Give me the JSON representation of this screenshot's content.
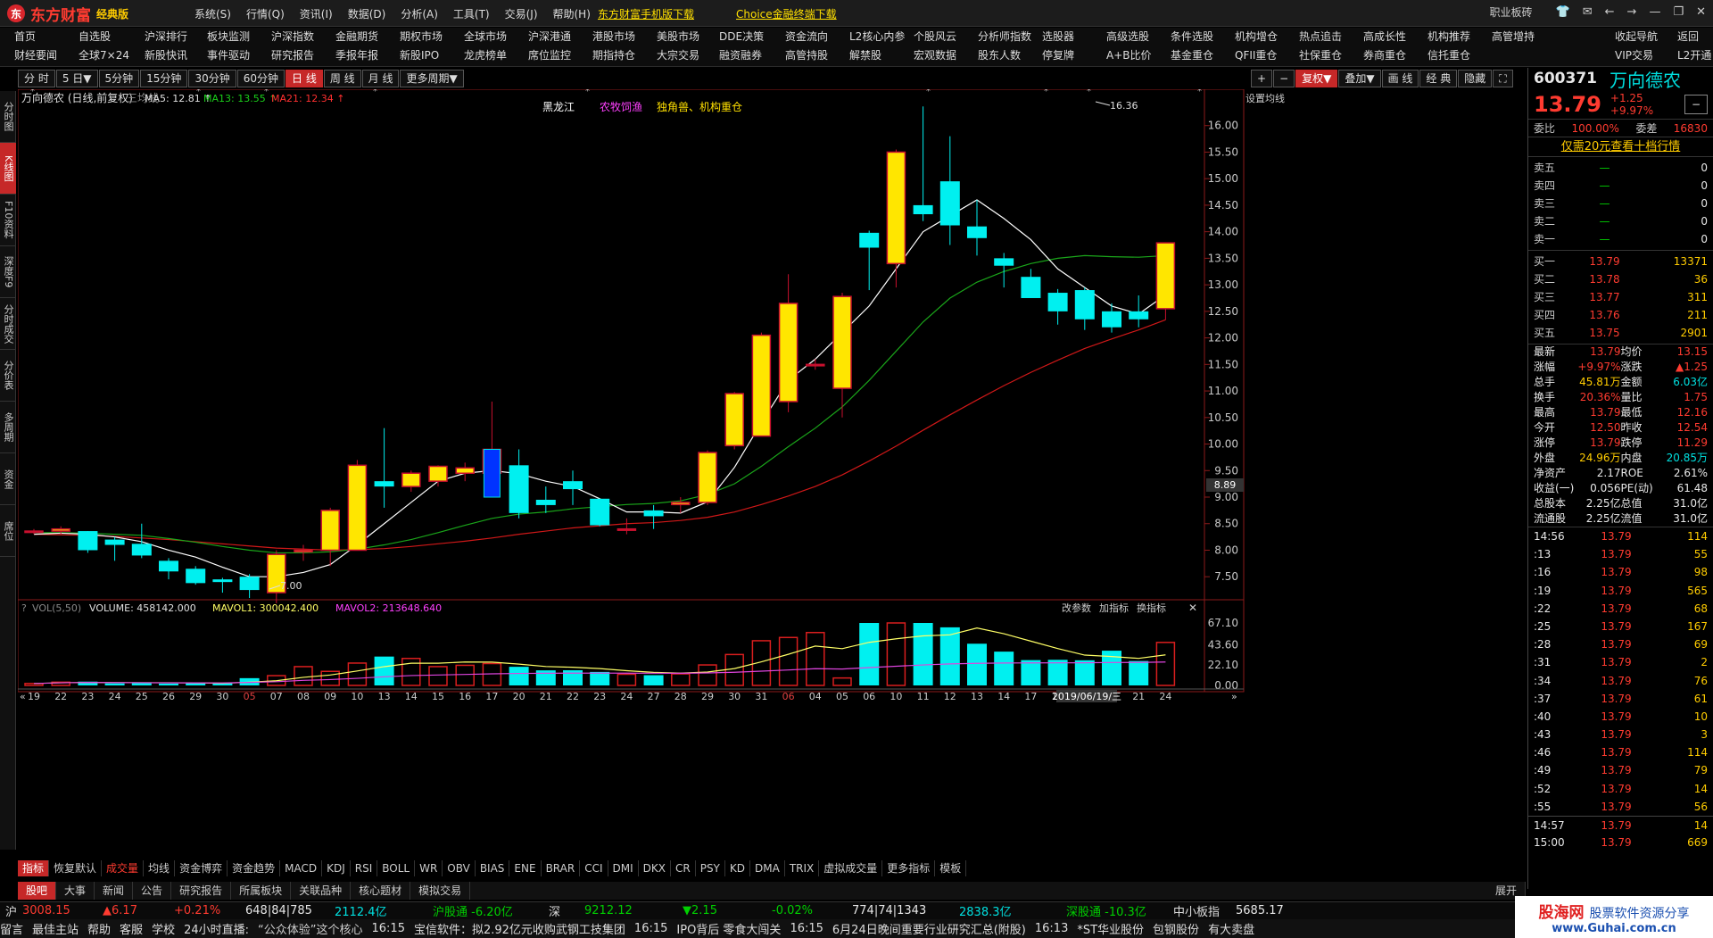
{
  "title": {
    "logo_cn": "东方财富",
    "edition": "经典版",
    "menus": [
      "系统(S)",
      "行情(Q)",
      "资讯(I)",
      "数据(D)",
      "分析(A)",
      "工具(T)",
      "交易(J)",
      "帮助(H)"
    ],
    "link1": "东方财富手机版下载",
    "link2": "Choice金融终端下载",
    "right": "职业板砖"
  },
  "nav": {
    "row1": [
      "首页",
      "自选股",
      "沪深排行",
      "板块监测",
      "沪深指数",
      "金融期货",
      "期权市场",
      "全球市场",
      "沪深港通",
      "港股市场",
      "美股市场",
      "DDE决策",
      "资金流向",
      "L2核心内参",
      "个股风云",
      "分析师指数",
      "选股器",
      "高级选股",
      "条件选股",
      "机构增仓",
      "热点追击",
      "高成长性",
      "机构推荐",
      "高管增持",
      "收起导航",
      "返回"
    ],
    "row2": [
      "财经要闻",
      "全球7×24",
      "新股快讯",
      "事件驱动",
      "研究报告",
      "季报年报",
      "新股IPO",
      "龙虎榜单",
      "席位监控",
      "期指持仓",
      "大宗交易",
      "融资融券",
      "高管持股",
      "解禁股",
      "宏观数据",
      "股东人数",
      "停复牌",
      "A+B比价",
      "基金重仓",
      "QFII重仓",
      "社保重仓",
      "券商重仓",
      "信托重仓",
      "",
      "VIP交易",
      "L2开通"
    ]
  },
  "toolbar": {
    "left": [
      "分 时",
      "5 日▼",
      "5分钟",
      "15分钟",
      "30分钟",
      "60分钟",
      "日 线",
      "周 线",
      "月 线",
      "更多周期▼"
    ],
    "active": "日 线",
    "right": [
      "+",
      "−",
      "复权▼",
      "叠加▼",
      "画 线",
      "经 典",
      "隐藏",
      "⛶"
    ]
  },
  "leftbar": [
    "分时图",
    "K线图",
    "F10资料",
    "深度F9",
    "分时成交",
    "分价表",
    "多周期",
    "资金",
    "席位"
  ],
  "chart": {
    "stock_title": "万向德农 (日线,前复权)",
    "ma_label": "三均线",
    "ma5": "MA5: 12.81 ↑",
    "ma13": "MA13: 13.55 ↑",
    "ma21": "MA21: 12.34 ↑",
    "set_ma": "设置均线",
    "tags": [
      "黑龙江",
      "农牧饲渔",
      "独角兽、机构重仓"
    ],
    "high_label": "16.36",
    "low_label": "7.00",
    "cur_price_tag": "8.89",
    "vol_label": "VOL(5,50)",
    "volume": "VOLUME: 458142.000",
    "mavol1": "MAVOL1: 300042.400",
    "mavol2": "MAVOL2: 213648.640",
    "vol_buttons": [
      "改参数",
      "加指标",
      "换指标"
    ],
    "date_tip": "2019/06/19/三"
  },
  "chart_data": {
    "type": "candlestick",
    "dates": [
      "19",
      "22",
      "23",
      "24",
      "25",
      "26",
      "29",
      "30",
      "05",
      "07",
      "08",
      "09",
      "10",
      "13",
      "14",
      "15",
      "16",
      "17",
      "20",
      "21",
      "22",
      "23",
      "24",
      "27",
      "28",
      "29",
      "30",
      "31",
      "03",
      "04",
      "05",
      "06",
      "10",
      "11",
      "12",
      "13",
      "14",
      "17",
      "18",
      "19",
      "20",
      "21",
      "24"
    ],
    "date_ticks": [
      "19",
      "22",
      "23",
      "24",
      "25",
      "26",
      "29",
      "30",
      "05",
      "07",
      "08",
      "09",
      "10",
      "13",
      "14",
      "15",
      "16",
      "17",
      "20",
      "21",
      "22",
      "23",
      "24",
      "27",
      "28",
      "29",
      "30",
      "31",
      "06",
      "04",
      "05",
      "06",
      "10",
      "11",
      "12",
      "13",
      "14",
      "17",
      "18",
      "19",
      "20",
      "21",
      "24"
    ],
    "open": [
      8.36,
      8.36,
      8.36,
      8.2,
      8.12,
      7.8,
      7.65,
      7.45,
      7.5,
      7.2,
      7.97,
      8.0,
      8.0,
      9.3,
      9.2,
      9.3,
      9.45,
      9.45,
      9.6,
      8.95,
      9.3,
      8.97,
      8.4,
      8.75,
      8.86,
      8.9,
      9.97,
      10.15,
      10.8,
      11.5,
      11.05,
      13.98,
      13.4,
      14.5,
      14.95,
      14.1,
      13.5,
      13.15,
      12.85,
      12.9,
      12.5,
      12.5,
      12.55
    ],
    "close": [
      8.36,
      8.4,
      8.0,
      8.1,
      7.9,
      7.6,
      7.38,
      7.4,
      7.25,
      7.92,
      8.0,
      8.75,
      9.6,
      9.2,
      9.45,
      9.58,
      9.55,
      9.9,
      8.7,
      8.85,
      9.15,
      8.47,
      8.4,
      8.64,
      8.9,
      9.84,
      10.95,
      12.05,
      12.65,
      11.5,
      12.78,
      13.7,
      15.5,
      14.33,
      14.12,
      13.88,
      13.36,
      12.75,
      12.5,
      12.35,
      12.2,
      12.35,
      13.79
    ],
    "high": [
      8.4,
      8.45,
      8.36,
      8.25,
      8.5,
      7.85,
      7.7,
      7.48,
      7.55,
      8.0,
      8.1,
      8.8,
      9.7,
      10.3,
      9.5,
      9.6,
      9.65,
      10.8,
      9.9,
      9.2,
      9.5,
      8.97,
      8.6,
      8.85,
      9.0,
      9.88,
      10.98,
      12.1,
      13.2,
      11.6,
      12.85,
      14.02,
      15.55,
      16.36,
      15.8,
      14.6,
      13.6,
      13.3,
      12.92,
      12.95,
      12.65,
      12.8,
      13.79
    ],
    "low": [
      8.3,
      8.3,
      7.95,
      7.8,
      7.85,
      7.45,
      7.35,
      7.2,
      7.1,
      7.0,
      7.8,
      7.7,
      8.2,
      8.8,
      9.1,
      9.2,
      9.3,
      9.4,
      8.6,
      8.7,
      8.85,
      8.45,
      8.3,
      8.4,
      8.7,
      8.85,
      9.9,
      10.3,
      10.6,
      11.4,
      10.5,
      12.9,
      12.95,
      14.2,
      13.75,
      13.55,
      12.95,
      12.75,
      12.25,
      12.15,
      12.1,
      12.2,
      12.34
    ],
    "volume": [
      2.1,
      3.5,
      4.1,
      2.2,
      2.8,
      2.0,
      2.6,
      2.3,
      7.8,
      10.5,
      20.2,
      15.1,
      24.0,
      31.0,
      29.0,
      20.2,
      21.6,
      23.5,
      20.0,
      16.2,
      16.3,
      14.5,
      12.0,
      11.0,
      12.4,
      22.0,
      33.2,
      48.0,
      51.5,
      56.8,
      8.0,
      67.1,
      67.1,
      67.1,
      62.4,
      44.8,
      36.3,
      27.2,
      27.5,
      27.0,
      37.3,
      26.2,
      46.2
    ],
    "ma5": [
      8.3,
      8.32,
      8.3,
      8.25,
      8.16,
      8.0,
      7.87,
      7.68,
      7.5,
      7.5,
      7.58,
      7.73,
      8.1,
      8.5,
      8.9,
      9.3,
      9.45,
      9.5,
      9.44,
      9.3,
      9.2,
      8.97,
      8.72,
      8.72,
      8.7,
      8.91,
      9.56,
      10.4,
      11.2,
      11.6,
      12.1,
      12.6,
      13.3,
      14.0,
      14.3,
      14.6,
      14.25,
      13.85,
      13.3,
      12.95,
      12.6,
      12.45,
      12.81
    ],
    "ma13": [
      8.33,
      8.33,
      8.32,
      8.3,
      8.28,
      8.22,
      8.15,
      8.07,
      8.0,
      7.95,
      7.95,
      7.97,
      8.02,
      8.1,
      8.2,
      8.33,
      8.47,
      8.6,
      8.68,
      8.72,
      8.78,
      8.82,
      8.86,
      8.88,
      8.93,
      9.05,
      9.25,
      9.58,
      9.95,
      10.3,
      10.7,
      11.2,
      11.75,
      12.3,
      12.75,
      13.05,
      13.25,
      13.4,
      13.5,
      13.55,
      13.53,
      13.52,
      13.55
    ],
    "ma21": [
      8.3,
      8.29,
      8.28,
      8.26,
      8.23,
      8.2,
      8.16,
      8.12,
      8.08,
      8.04,
      8.02,
      8.0,
      8.01,
      8.03,
      8.07,
      8.12,
      8.17,
      8.23,
      8.3,
      8.36,
      8.42,
      8.46,
      8.5,
      8.52,
      8.56,
      8.62,
      8.72,
      8.86,
      9.02,
      9.2,
      9.42,
      9.68,
      9.96,
      10.26,
      10.55,
      10.83,
      11.1,
      11.35,
      11.58,
      11.8,
      11.98,
      12.15,
      12.34
    ],
    "y_ticks": [
      7.5,
      8.0,
      8.5,
      9.0,
      9.5,
      10.0,
      10.5,
      11.0,
      11.5,
      12.0,
      12.5,
      13.0,
      13.5,
      14.0,
      14.5,
      15.0,
      15.5,
      16.0
    ],
    "vol_ticks": [
      "67.10",
      "43.60",
      "22.10",
      "0.00"
    ],
    "colors": {
      "up": "#ffe600",
      "down": "#00f0f0",
      "ma5": "#ffffff",
      "ma13": "#1aa51a",
      "ma21": "#d01818",
      "mavol1": "#ffff66",
      "mavol2": "#dd44dd"
    }
  },
  "quote": {
    "code": "600371",
    "name": "万向德农",
    "price": "13.79",
    "chg": "+1.25",
    "pct": "+9.97%",
    "weibi_l": "委比",
    "weibi": "100.00%",
    "weicha_l": "委差",
    "weicha": "16830",
    "promo": "仅需20元查看十档行情",
    "asks": [
      [
        "卖五",
        "—",
        "0"
      ],
      [
        "卖四",
        "—",
        "0"
      ],
      [
        "卖三",
        "—",
        "0"
      ],
      [
        "卖二",
        "—",
        "0"
      ],
      [
        "卖一",
        "—",
        "0"
      ]
    ],
    "bids": [
      [
        "买一",
        "13.79",
        "13371"
      ],
      [
        "买二",
        "13.78",
        "36"
      ],
      [
        "买三",
        "13.77",
        "311"
      ],
      [
        "买四",
        "13.76",
        "211"
      ],
      [
        "买五",
        "13.75",
        "2901"
      ]
    ],
    "stats": [
      [
        "最新",
        "13.79",
        "均价",
        "13.15"
      ],
      [
        "涨幅",
        "+9.97%",
        "涨跌",
        "▲1.25"
      ],
      [
        "总手",
        "45.81万",
        "金额",
        "6.03亿"
      ],
      [
        "换手",
        "20.36%",
        "量比",
        "1.75"
      ],
      [
        "最高",
        "13.79",
        "最低",
        "12.16"
      ],
      [
        "今开",
        "12.50",
        "昨收",
        "12.54"
      ],
      [
        "涨停",
        "13.79",
        "跌停",
        "11.29"
      ],
      [
        "外盘",
        "24.96万",
        "内盘",
        "20.85万"
      ],
      [
        "净资产",
        "2.17",
        "ROE",
        "2.61%"
      ],
      [
        "收益(一)",
        "0.056",
        "PE(动)",
        "61.48"
      ],
      [
        "总股本",
        "2.25亿",
        "总值",
        "31.0亿"
      ],
      [
        "流通股",
        "2.25亿",
        "流值",
        "31.0亿"
      ]
    ],
    "ticks": [
      [
        "14:56",
        "13.79",
        "114"
      ],
      [
        ":13",
        "13.79",
        "55"
      ],
      [
        ":16",
        "13.79",
        "98"
      ],
      [
        ":19",
        "13.79",
        "565"
      ],
      [
        ":22",
        "13.79",
        "68"
      ],
      [
        ":25",
        "13.79",
        "167"
      ],
      [
        ":28",
        "13.79",
        "69"
      ],
      [
        ":31",
        "13.79",
        "2"
      ],
      [
        ":34",
        "13.79",
        "76"
      ],
      [
        ":37",
        "13.79",
        "61"
      ],
      [
        ":40",
        "13.79",
        "10"
      ],
      [
        ":43",
        "13.79",
        "3"
      ],
      [
        ":46",
        "13.79",
        "114"
      ],
      [
        ":49",
        "13.79",
        "79"
      ],
      [
        ":52",
        "13.79",
        "14"
      ],
      [
        ":55",
        "13.79",
        "56"
      ],
      [
        "14:57",
        "13.79",
        "14"
      ],
      [
        "15:00",
        "13.79",
        "669"
      ]
    ]
  },
  "bottom_tabs": [
    "指标",
    "恢复默认",
    "成交量",
    "均线",
    "资金博弈",
    "资金趋势",
    "MACD",
    "KDJ",
    "RSI",
    "BOLL",
    "WR",
    "OBV",
    "BIAS",
    "ENE",
    "BRAR",
    "CCI",
    "DMI",
    "DKX",
    "CR",
    "PSY",
    "KD",
    "DMA",
    "TRIX",
    "虚拟成交量",
    "更多指标",
    "模板"
  ],
  "news_tabs": [
    "股吧",
    "大事",
    "新闻",
    "公告",
    "研究报告",
    "所属板块",
    "关联品种",
    "核心题材",
    "模拟交易",
    "展开"
  ],
  "index": {
    "sh_label": "沪",
    "sh": "3008.15",
    "sh_chg": "▲6.17",
    "sh_pct": "+0.21%",
    "sh_ud": "648|84|785",
    "sh_amt": "2112.4亿",
    "hgt": "沪股通 -6.20亿",
    "sz_label": "深",
    "sz": "9212.12",
    "sz_chg": "▼2.15",
    "sz_pct": "-0.02%",
    "sz_ud": "774|74|1343",
    "sz_amt": "2838.3亿",
    "sgt": "深股通 -10.3亿",
    "zxb_label": "中小板指",
    "zxb": "5685.17"
  },
  "news": {
    "items": [
      "留言",
      "最佳主站",
      "帮助",
      "客服",
      "学校",
      "24小时直播:",
      "“公众体验”这个核心",
      "16:15",
      "宝信软件：拟2.92亿元收购武钢工技集团",
      "16:15",
      "IPO背后 零食大闯关",
      "16:15",
      "6月24日晚间重要行业研究汇总(附股)",
      "16:13",
      "*ST华业股份",
      "包钢股份",
      "有大卖盘"
    ]
  },
  "watermark": {
    "a": "股海网",
    "b": "股票软件资源分享",
    "c": "www.Guhai.com.cn"
  }
}
